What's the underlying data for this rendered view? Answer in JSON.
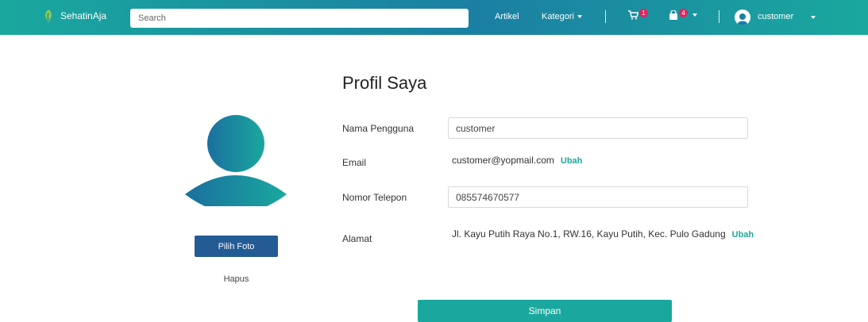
{
  "navbar": {
    "brand": "SehatinAja",
    "search_placeholder": "Search",
    "artikel": "Artikel",
    "kategori": "Kategori",
    "cart_count": "1",
    "bag_count": "4",
    "username": "customer"
  },
  "profile": {
    "title": "Profil Saya",
    "pick_photo": "Pilih Foto",
    "remove": "Hapus",
    "labels": {
      "username": "Nama Pengguna",
      "email": "Email",
      "phone": "Nomor Telepon",
      "address": "Alamat"
    },
    "values": {
      "username": "customer",
      "email": "customer@yopmail.com",
      "phone": "085574670577",
      "address": "Jl. Kayu Putih Raya No.1, RW.16, Kayu Putih, Kec. Pulo Gadung"
    },
    "change": "Ubah",
    "save": "Simpan"
  },
  "colors": {
    "primary": "#1aa89e",
    "accent_blue": "#235b95",
    "badge": "#e0245e"
  }
}
